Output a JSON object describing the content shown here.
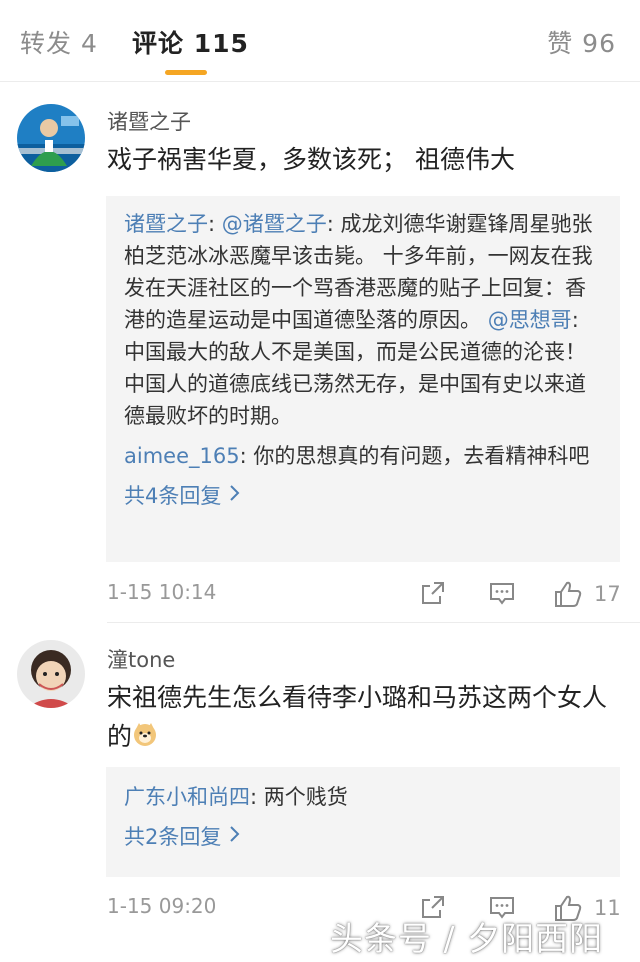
{
  "tabs": {
    "repost": "转发 4",
    "comments": "评论 115",
    "likes": "赞 96"
  },
  "comments": [
    {
      "username": "诸暨之子",
      "content": "戏子祸害华夏，多数该死；  祖德伟大",
      "replies": [
        {
          "name": "诸暨之子",
          "sep": ": ",
          "mention1": "@诸暨之子",
          "text1": ": 成龙刘德华谢霆锋周星驰张柏芝范冰冰恶魔早该击毙。 十多年前，一网友在我发在天涯社区的一个骂香港恶魔的贴子上回复：香港的造星运动是中国道德坠落的原因。 ",
          "mention2": "@思想哥",
          "text2": ": 中国最大的敌人不是美国，而是公民道德的沦丧！中国人的道德底线已荡然无存，是中国有史以来道德最败坏的时期。"
        },
        {
          "name": "aimee_165",
          "text": ": 你的思想真的有问题，去看精神科吧"
        }
      ],
      "more_replies": "共4条回复",
      "time": "1-15 10:14",
      "like_count": "17"
    },
    {
      "username": "潼tone",
      "content": "宋祖德先生怎么看待李小璐和马苏这两个女人的",
      "emoji": "doge",
      "replies": [
        {
          "name": "广东小和尚四",
          "text": ": 两个贱货"
        }
      ],
      "more_replies": "共2条回复",
      "time": "1-15 09:20",
      "like_count": "11"
    }
  ],
  "watermark": "头条号 / 夕阳西阳",
  "icons": {
    "share": "share-icon",
    "comment": "comment-icon",
    "like": "thumbs-up-icon",
    "chevron": "chevron-right-icon"
  },
  "colors": {
    "accent": "#f5a623",
    "link": "#4d7fb5",
    "muted": "#999999"
  }
}
